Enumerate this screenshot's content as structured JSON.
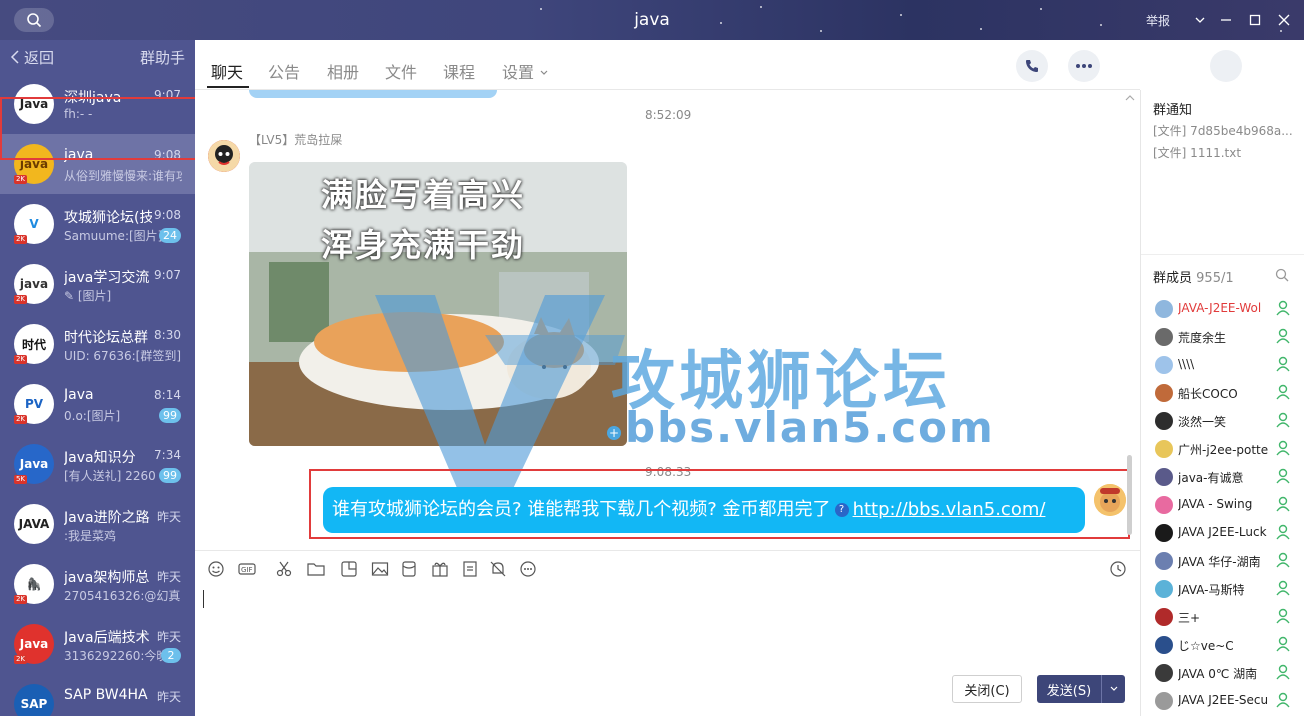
{
  "window": {
    "title": "java",
    "report": "举报"
  },
  "sidebar": {
    "back": "返回",
    "helper": "群助手",
    "conversations": [
      {
        "name": "深圳java",
        "time": "9:07",
        "preview": "fh:- -",
        "count": "",
        "avatar_text": "Java",
        "avatar_bg": "#ffffff",
        "avatar_fg": "#222222",
        "level_badge": ""
      },
      {
        "name": "java",
        "time": "9:08",
        "preview": "从俗到雅慢慢来:谁有攻",
        "count": "",
        "avatar_text": "java",
        "avatar_bg": "#f2b71e",
        "avatar_fg": "#6b3b00",
        "level_badge": "2K"
      },
      {
        "name": "攻城狮论坛(技",
        "time": "9:08",
        "preview": "Samuume:[图片]",
        "count": "24",
        "avatar_text": "V",
        "avatar_bg": "#ffffff",
        "avatar_fg": "#1e8be0",
        "level_badge": "2K"
      },
      {
        "name": "java学习交流",
        "time": "9:07",
        "preview": "✎ [图片]",
        "count": "",
        "avatar_text": "java",
        "avatar_bg": "#ffffff",
        "avatar_fg": "#333333",
        "level_badge": "2K"
      },
      {
        "name": "时代论坛总群",
        "time": "8:30",
        "preview": "UID: 67636:[群签到]",
        "count": "",
        "avatar_text": "时代",
        "avatar_bg": "#ffffff",
        "avatar_fg": "#111111",
        "level_badge": "2K"
      },
      {
        "name": "Java",
        "time": "8:14",
        "preview": "0.o:[图片]",
        "count": "99",
        "avatar_text": "PV",
        "avatar_bg": "#ffffff",
        "avatar_fg": "#1c64c4",
        "level_badge": "2K"
      },
      {
        "name": "Java知识分",
        "time": "7:34",
        "preview": "[有人送礼] 2260",
        "count": "99",
        "avatar_text": "Java",
        "avatar_bg": "#2767c9",
        "avatar_fg": "#ffffff",
        "level_badge": "5K"
      },
      {
        "name": "Java进阶之路",
        "time": "昨天",
        "preview": ":我是菜鸡",
        "count": "",
        "avatar_text": "JAVA",
        "avatar_bg": "#ffffff",
        "avatar_fg": "#222222",
        "level_badge": ""
      },
      {
        "name": "java架构师总",
        "time": "昨天",
        "preview": "2705416326:@幻真",
        "count": "",
        "avatar_text": "🦍",
        "avatar_bg": "#ffffff",
        "avatar_fg": "#222222",
        "level_badge": "2K"
      },
      {
        "name": "Java后端技术",
        "time": "昨天",
        "preview": "3136292260:今晚",
        "count": "2",
        "avatar_text": "Java",
        "avatar_bg": "#e0322d",
        "avatar_fg": "#ffffff",
        "level_badge": "2K"
      },
      {
        "name": "SAP BW4HA",
        "time": "昨天",
        "preview": "",
        "count": "",
        "avatar_text": "SAP",
        "avatar_bg": "#1a5fb4",
        "avatar_fg": "#ffffff",
        "level_badge": ""
      }
    ]
  },
  "tabs": [
    {
      "label": "聊天"
    },
    {
      "label": "公告"
    },
    {
      "label": "相册"
    },
    {
      "label": "文件"
    },
    {
      "label": "课程"
    },
    {
      "label": "设置"
    }
  ],
  "chat": {
    "timestamp1": "8:52:09",
    "sender": "【LV5】荒岛拉屎",
    "meme_line1": "满脸写着高兴",
    "meme_line2": "浑身充满干劲",
    "timestamp2": "9:08:33",
    "my_message": "谁有攻城狮论坛的会员? 谁能帮我下载几个视频? 金币都用完了",
    "my_link": "http://bbs.vlan5.com/",
    "watermark_cn": "攻城狮论坛",
    "watermark_en": "bbs.vlan5.com"
  },
  "toolbar_icons": [
    "emoji-icon",
    "gif-icon",
    "scissors-icon",
    "folder-icon",
    "sticker-icon",
    "image-icon",
    "red-packet-icon",
    "gift-icon",
    "doc-icon",
    "bell-off-icon",
    "more-icon",
    "history-icon"
  ],
  "input": {
    "close_label": "关闭(C)",
    "send_label": "发送(S)"
  },
  "notice": {
    "title": "群通知",
    "items": [
      "[文件] 7d85be4b968a...",
      "[文件] 1111.txt"
    ]
  },
  "members": {
    "title": "群成员",
    "count": "955/1",
    "list": [
      {
        "name": "JAVA-J2EE-Wol",
        "color": "#e13b3b",
        "avatar_bg": "#8fb7de"
      },
      {
        "name": "荒度余生",
        "color": "#222222",
        "avatar_bg": "#6a6a6a"
      },
      {
        "name": "\\\\\\\\",
        "color": "#222222",
        "avatar_bg": "#9ec3ea"
      },
      {
        "name": "船长COCO",
        "color": "#222222",
        "avatar_bg": "#c06a3a"
      },
      {
        "name": "淡然一笑",
        "color": "#222222",
        "avatar_bg": "#2d2d2d"
      },
      {
        "name": "广州-j2ee-potte",
        "color": "#222222",
        "avatar_bg": "#e8c65a"
      },
      {
        "name": "java-有诚意",
        "color": "#222222",
        "avatar_bg": "#5a5a8a"
      },
      {
        "name": "JAVA -  Swing",
        "color": "#222222",
        "avatar_bg": "#e86aa0"
      },
      {
        "name": "JAVA J2EE-Luck",
        "color": "#222222",
        "avatar_bg": "#1a1a1a"
      },
      {
        "name": "JAVA 华仔-湖南",
        "color": "#222222",
        "avatar_bg": "#6b7fb0"
      },
      {
        "name": "JAVA-马斯特",
        "color": "#222222",
        "avatar_bg": "#5bb2d8"
      },
      {
        "name": "三+",
        "color": "#222222",
        "avatar_bg": "#b02a2a"
      },
      {
        "name": "じ☆ve~C",
        "color": "#222222",
        "avatar_bg": "#2a4f8c"
      },
      {
        "name": "JAVA 0℃ 湖南",
        "color": "#222222",
        "avatar_bg": "#3a3a3a"
      },
      {
        "name": "JAVA J2EE-Secu",
        "color": "#222222",
        "avatar_bg": "#9a9a9a"
      }
    ]
  },
  "colors": {
    "accent": "#12b7f5",
    "sidebar": "#4f5590",
    "highlight": "#e13b3b",
    "member_icon": "#41b66b"
  }
}
